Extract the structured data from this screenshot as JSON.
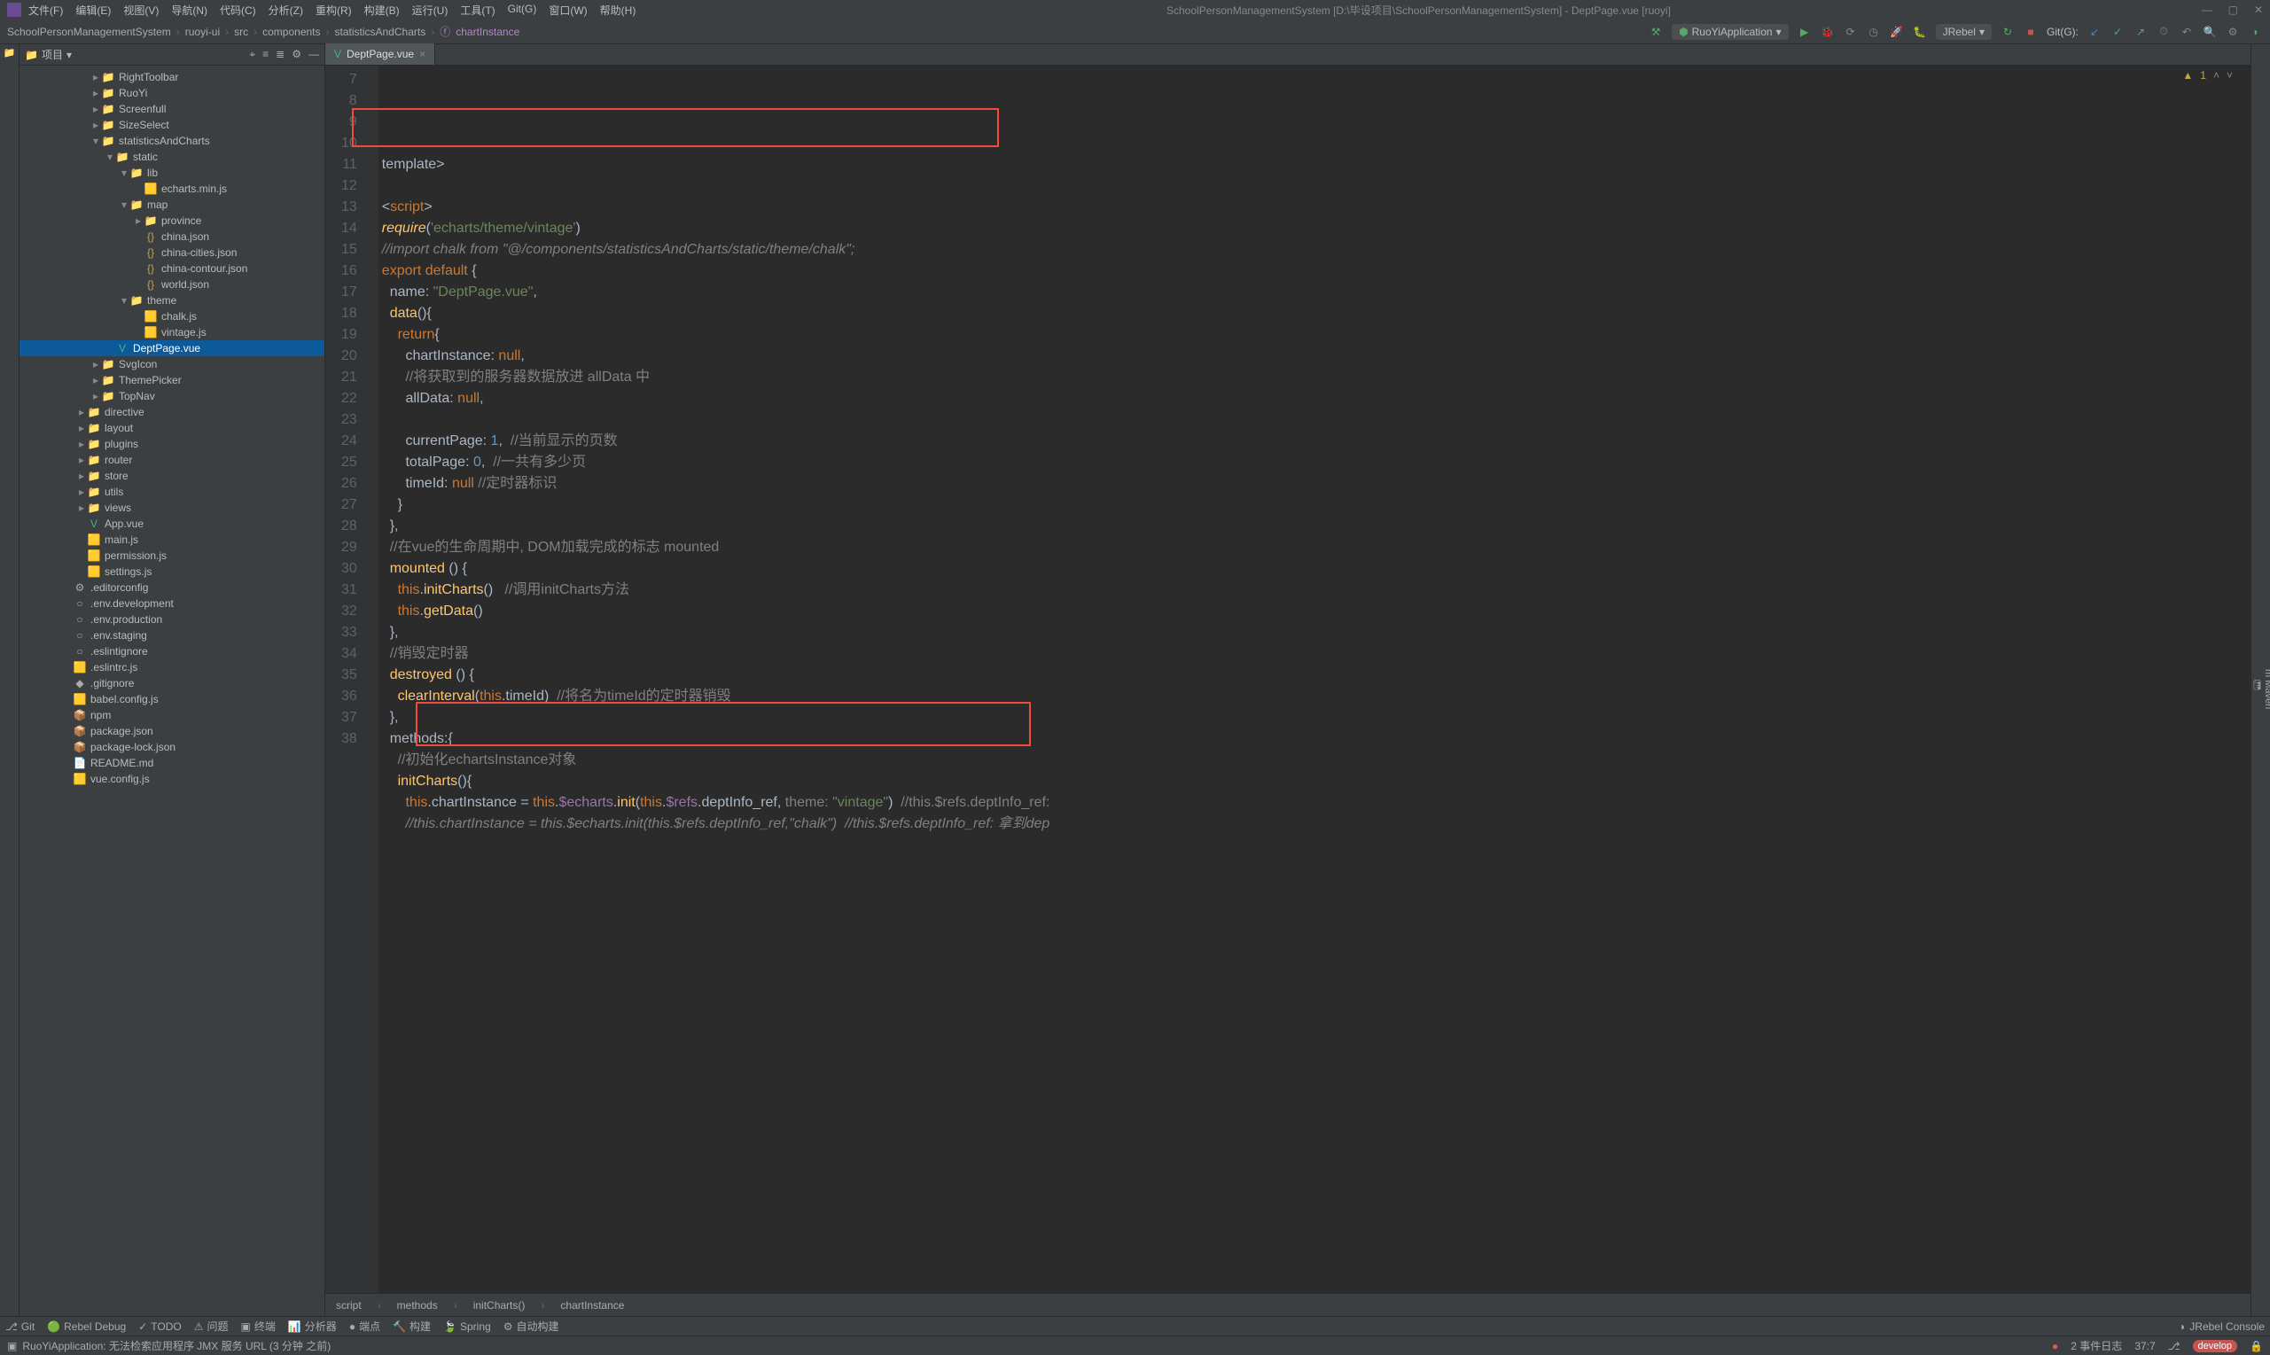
{
  "title_bar": {
    "menus": [
      "文件(F)",
      "编辑(E)",
      "视图(V)",
      "导航(N)",
      "代码(C)",
      "分析(Z)",
      "重构(R)",
      "构建(B)",
      "运行(U)",
      "工具(T)",
      "Git(G)",
      "窗口(W)",
      "帮助(H)"
    ],
    "title": "SchoolPersonManagementSystem [D:\\毕设项目\\SchoolPersonManagementSystem] - DeptPage.vue [ruoyi]"
  },
  "breadcrumb": {
    "items": [
      "SchoolPersonManagementSystem",
      "ruoyi-ui",
      "src",
      "components",
      "statisticsAndCharts",
      "chartInstance"
    ],
    "last_icon": "field",
    "run_config": "RuoYiApplication",
    "gitg_label": "Git(G):",
    "jrebel_label": "JRebel"
  },
  "project": {
    "title": "项目",
    "tree": [
      {
        "d": 5,
        "a": ">",
        "i": "📁",
        "c": "fold",
        "t": "RightToolbar"
      },
      {
        "d": 5,
        "a": ">",
        "i": "📁",
        "c": "fold",
        "t": "RuoYi"
      },
      {
        "d": 5,
        "a": ">",
        "i": "📁",
        "c": "fold",
        "t": "Screenfull"
      },
      {
        "d": 5,
        "a": ">",
        "i": "📁",
        "c": "fold",
        "t": "SizeSelect"
      },
      {
        "d": 5,
        "a": "v",
        "i": "📁",
        "c": "fold",
        "t": "statisticsAndCharts"
      },
      {
        "d": 6,
        "a": "v",
        "i": "📁",
        "c": "fold",
        "t": "static"
      },
      {
        "d": 7,
        "a": "v",
        "i": "📁",
        "c": "fold",
        "t": "lib"
      },
      {
        "d": 8,
        "a": "",
        "i": "🟨",
        "c": "fjs",
        "t": "echarts.min.js"
      },
      {
        "d": 7,
        "a": "v",
        "i": "📁",
        "c": "fold",
        "t": "map"
      },
      {
        "d": 8,
        "a": ">",
        "i": "📁",
        "c": "fold",
        "t": "province"
      },
      {
        "d": 8,
        "a": "",
        "i": "{}",
        "c": "fjson",
        "t": "china.json"
      },
      {
        "d": 8,
        "a": "",
        "i": "{}",
        "c": "fjson",
        "t": "china-cities.json"
      },
      {
        "d": 8,
        "a": "",
        "i": "{}",
        "c": "fjson",
        "t": "china-contour.json"
      },
      {
        "d": 8,
        "a": "",
        "i": "{}",
        "c": "fjson",
        "t": "world.json"
      },
      {
        "d": 7,
        "a": "v",
        "i": "📁",
        "c": "fold",
        "t": "theme"
      },
      {
        "d": 8,
        "a": "",
        "i": "🟨",
        "c": "fjs",
        "t": "chalk.js"
      },
      {
        "d": 8,
        "a": "",
        "i": "🟨",
        "c": "fjs",
        "t": "vintage.js"
      },
      {
        "d": 6,
        "a": "",
        "i": "V",
        "c": "fvue",
        "t": "DeptPage.vue",
        "sel": true
      },
      {
        "d": 5,
        "a": ">",
        "i": "📁",
        "c": "fold",
        "t": "SvgIcon"
      },
      {
        "d": 5,
        "a": ">",
        "i": "📁",
        "c": "fold",
        "t": "ThemePicker"
      },
      {
        "d": 5,
        "a": ">",
        "i": "📁",
        "c": "fold",
        "t": "TopNav"
      },
      {
        "d": 4,
        "a": ">",
        "i": "📁",
        "c": "fold",
        "t": "directive"
      },
      {
        "d": 4,
        "a": ">",
        "i": "📁",
        "c": "fold",
        "t": "layout"
      },
      {
        "d": 4,
        "a": ">",
        "i": "📁",
        "c": "fold",
        "t": "plugins"
      },
      {
        "d": 4,
        "a": ">",
        "i": "📁",
        "c": "fold",
        "t": "router"
      },
      {
        "d": 4,
        "a": ">",
        "i": "📁",
        "c": "fold",
        "t": "store"
      },
      {
        "d": 4,
        "a": ">",
        "i": "📁",
        "c": "fold",
        "t": "utils"
      },
      {
        "d": 4,
        "a": ">",
        "i": "📁",
        "c": "fold",
        "t": "views"
      },
      {
        "d": 4,
        "a": "",
        "i": "V",
        "c": "fvue",
        "t": "App.vue"
      },
      {
        "d": 4,
        "a": "",
        "i": "🟨",
        "c": "fjs",
        "t": "main.js"
      },
      {
        "d": 4,
        "a": "",
        "i": "🟨",
        "c": "fjs",
        "t": "permission.js"
      },
      {
        "d": 4,
        "a": "",
        "i": "🟨",
        "c": "fjs",
        "t": "settings.js"
      },
      {
        "d": 3,
        "a": "",
        "i": "⚙",
        "c": "fcfg",
        "t": ".editorconfig"
      },
      {
        "d": 3,
        "a": "",
        "i": "○",
        "c": "fcfg",
        "t": ".env.development"
      },
      {
        "d": 3,
        "a": "",
        "i": "○",
        "c": "fcfg",
        "t": ".env.production"
      },
      {
        "d": 3,
        "a": "",
        "i": "○",
        "c": "fcfg",
        "t": ".env.staging"
      },
      {
        "d": 3,
        "a": "",
        "i": "○",
        "c": "fcfg",
        "t": ".eslintignore"
      },
      {
        "d": 3,
        "a": "",
        "i": "🟨",
        "c": "fjs",
        "t": ".eslintrc.js"
      },
      {
        "d": 3,
        "a": "",
        "i": "◆",
        "c": "fcfg",
        "t": ".gitignore"
      },
      {
        "d": 3,
        "a": "",
        "i": "🟨",
        "c": "fjs",
        "t": "babel.config.js"
      },
      {
        "d": 3,
        "a": "",
        "i": "📦",
        "c": "fcfg",
        "t": "npm"
      },
      {
        "d": 3,
        "a": "",
        "i": "📦",
        "c": "fjson",
        "t": "package.json"
      },
      {
        "d": 3,
        "a": "",
        "i": "📦",
        "c": "fjson",
        "t": "package-lock.json"
      },
      {
        "d": 3,
        "a": "",
        "i": "📄",
        "c": "fcfg",
        "t": "README.md"
      },
      {
        "d": 3,
        "a": "",
        "i": "🟨",
        "c": "fjs",
        "t": "vue.config.js"
      }
    ]
  },
  "editor": {
    "tab": "DeptPage.vue",
    "lines": [
      {
        "n": 7,
        "h": "</<span class='kw'>template</span>>"
      },
      {
        "n": 8,
        "h": ""
      },
      {
        "n": 9,
        "h": "<<span class='kw'>script</span>>"
      },
      {
        "n": 10,
        "h": "<span class='fn' style='font-style:italic'>require</span>(<span class='str'>'echarts/theme/vintage'</span>)"
      },
      {
        "n": 11,
        "h": "<span class='cmti'>//import chalk from \"@/components/statisticsAndCharts/static/theme/chalk\";</span>"
      },
      {
        "n": 12,
        "h": "<span class='kw'>export default</span> {"
      },
      {
        "n": 13,
        "h": "  name: <span class='str'>\"DeptPage.vue\"</span>,"
      },
      {
        "n": 14,
        "h": "  <span class='fn'>data</span>(){"
      },
      {
        "n": 15,
        "h": "    <span class='kw'>return</span>{"
      },
      {
        "n": 16,
        "h": "      chartInstance: <span class='kw'>null</span>,"
      },
      {
        "n": 17,
        "h": "      <span class='cmt'>//将获取到的服务器数据放进 allData 中</span>"
      },
      {
        "n": 18,
        "h": "      allData: <span class='kw'>null</span>,"
      },
      {
        "n": 19,
        "h": ""
      },
      {
        "n": 20,
        "h": "      currentPage: <span class='num'>1</span>,  <span class='cmt'>//当前显示的页数</span>"
      },
      {
        "n": 21,
        "h": "      totalPage: <span class='num'>0</span>,  <span class='cmt'>//一共有多少页</span>"
      },
      {
        "n": 22,
        "h": "      timeId: <span class='kw'>null</span> <span class='cmt'>//定时器标识</span>"
      },
      {
        "n": 23,
        "h": "    }"
      },
      {
        "n": 24,
        "h": "  },"
      },
      {
        "n": 25,
        "h": "  <span class='cmt'>//在vue的生命周期中, DOM加载完成的标志 mounted</span>"
      },
      {
        "n": 26,
        "h": "  <span class='fn'>mounted</span> () {"
      },
      {
        "n": 27,
        "h": "    <span class='kw'>this</span>.<span class='fn'>initCharts</span>()   <span class='cmt'>//调用initCharts方法</span>"
      },
      {
        "n": 28,
        "h": "    <span class='kw'>this</span>.<span class='fn'>getData</span>()"
      },
      {
        "n": 29,
        "h": "  },"
      },
      {
        "n": 30,
        "h": "  <span class='cmt'>//销毁定时器</span>"
      },
      {
        "n": 31,
        "h": "  <span class='fn'>destroyed</span> () {"
      },
      {
        "n": 32,
        "h": "    <span class='fn'>clearInterval</span>(<span class='kw'>this</span>.timeId)  <span class='cmt'>//将名为timeId的定时器销毁</span>"
      },
      {
        "n": 33,
        "h": "  },"
      },
      {
        "n": 34,
        "h": "  methods:{"
      },
      {
        "n": 35,
        "h": "    <span class='cmt'>//初始化echartsInstance对象</span>"
      },
      {
        "n": 36,
        "h": "    <span class='fn'>initCharts</span>(){"
      },
      {
        "n": 37,
        "h": "      <span class='kw'>this</span>.chartInstance = <span class='kw'>this</span>.<span class='prop'>$echarts</span>.<span class='fn'>init</span>(<span class='kw'>this</span>.<span class='prop'>$refs</span>.deptInfo_ref, <span class='hl-param'>theme:</span> <span class='str'>\"vintage\"</span>)  <span class='cmt'>//this.$refs.deptInfo_ref:</span>"
      },
      {
        "n": 38,
        "h": "      <span class='cmti'>//this.chartInstance = this.$echarts.init(this.$refs.deptInfo_ref,\"chalk\")  //this.$refs.deptInfo_ref: 拿到dep</span>"
      }
    ],
    "warning_count": "1",
    "breadcrumb": [
      "script",
      "methods",
      "initCharts()",
      "chartInstance"
    ]
  },
  "bottom_tools": {
    "items": [
      "Git",
      "Rebel Debug",
      "TODO",
      "问题",
      "终端",
      "分析器",
      "端点",
      "构建",
      "Spring",
      "自动构建"
    ],
    "right": "JRebel Console"
  },
  "status_bar": {
    "message": "RuoYiApplication: 无法检索应用程序 JMX 服务 URL (3 分钟 之前)",
    "events": "2  事件日志",
    "pos": "37:7",
    "branch": "develop",
    "lock": "🔒"
  }
}
